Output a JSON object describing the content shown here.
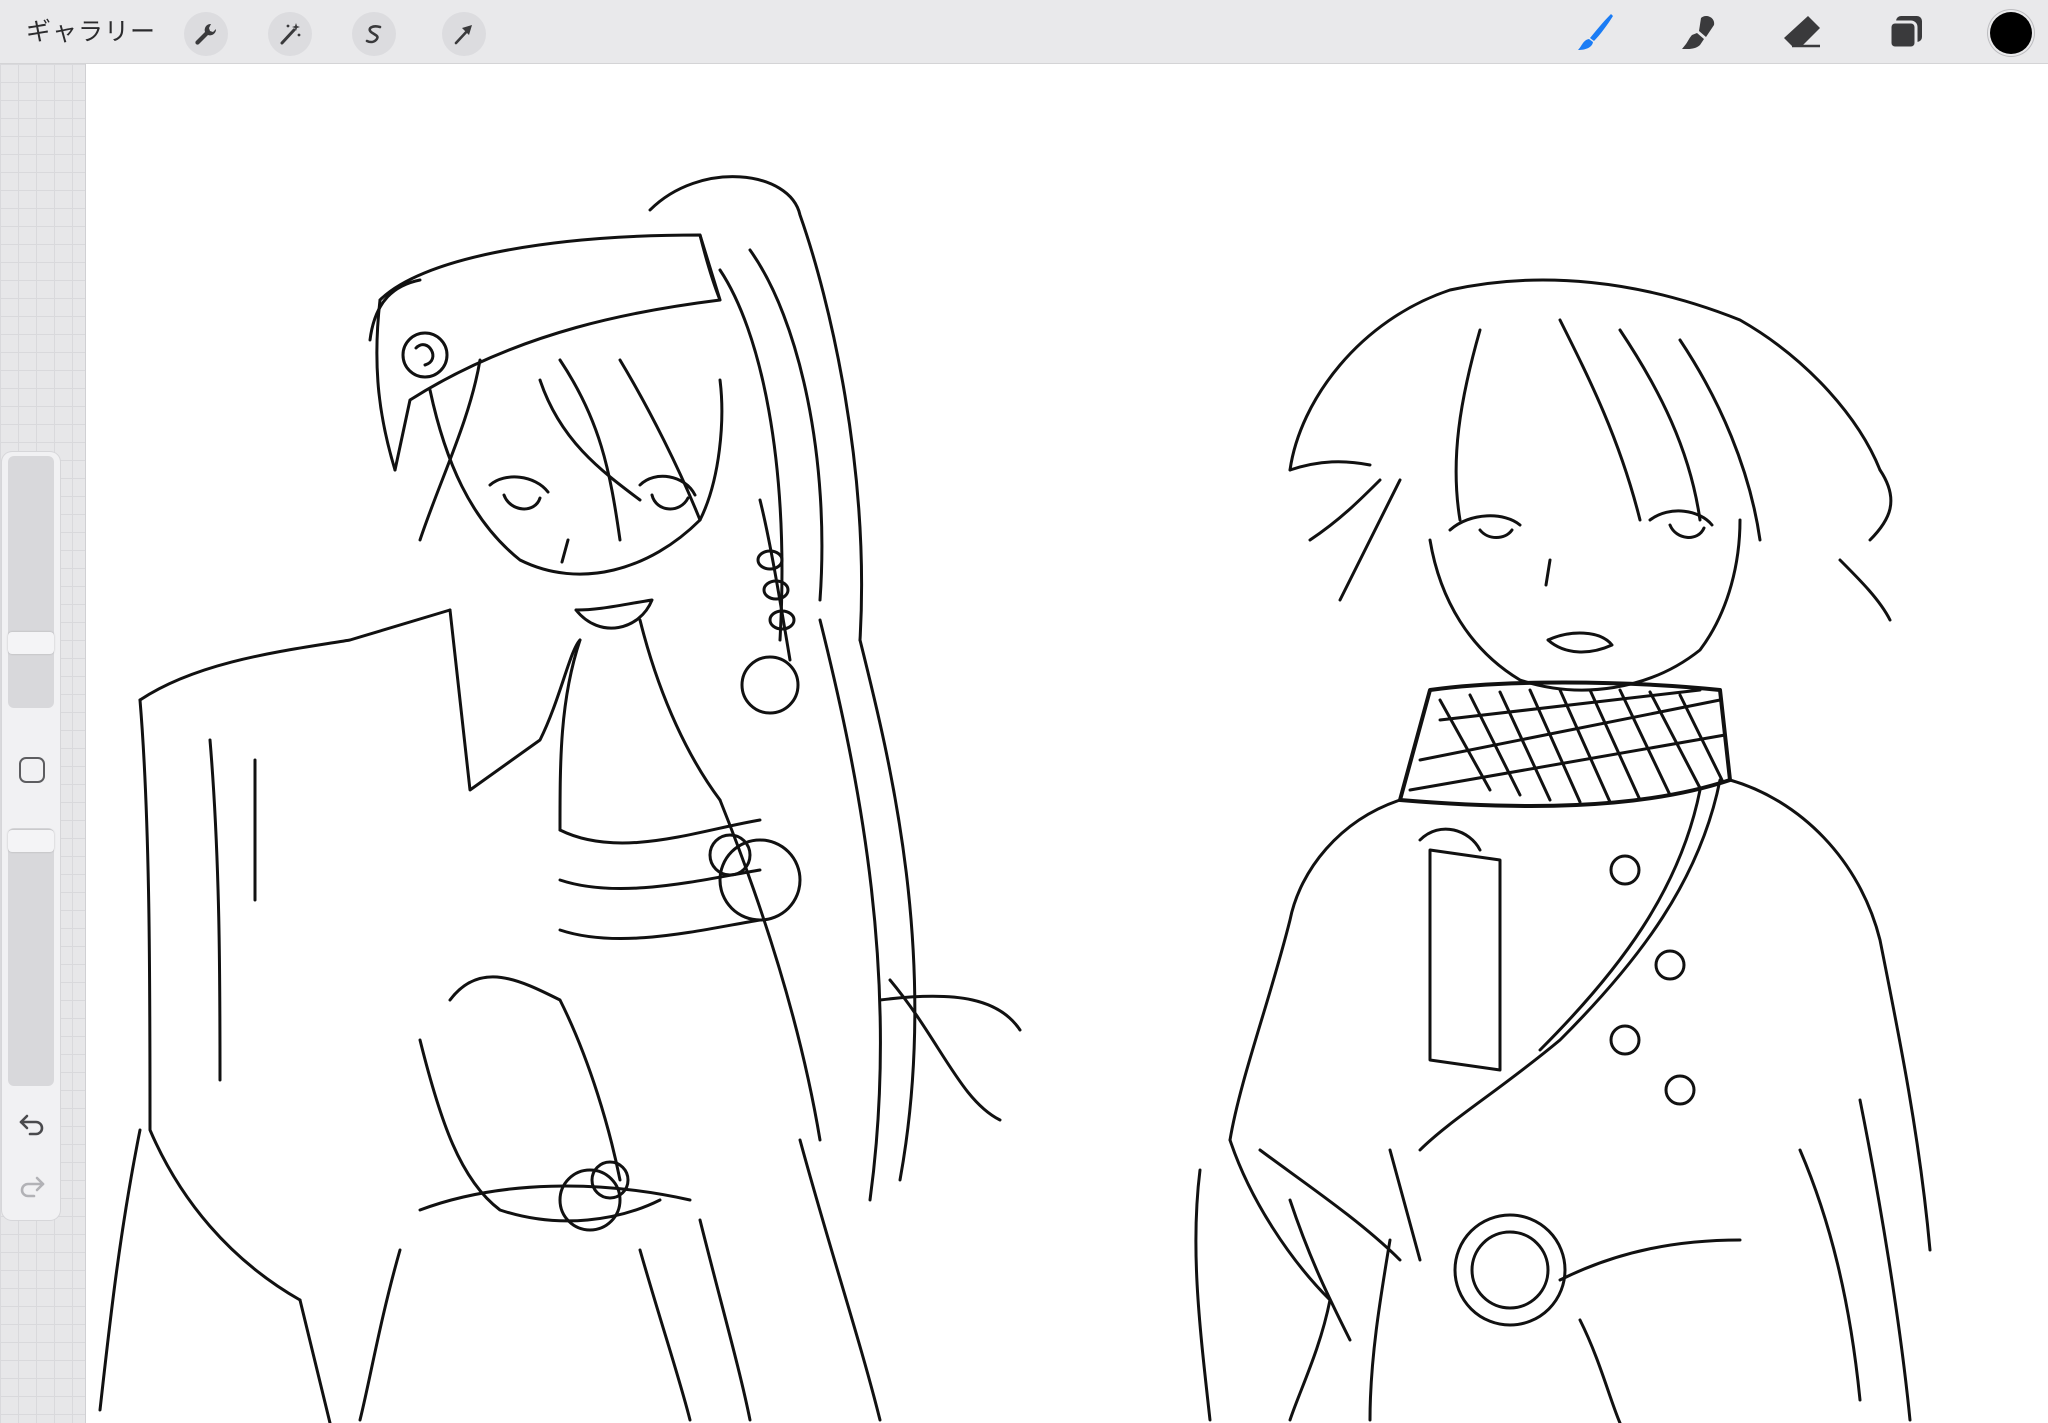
{
  "toolbar": {
    "gallery_label": "ギャラリー",
    "left_tools": [
      "wrench-icon",
      "magic-wand-icon",
      "selection-icon",
      "transform-arrow-icon"
    ],
    "right_tools": [
      "brush-icon",
      "smudge-icon",
      "eraser-icon",
      "layers-icon"
    ],
    "active_tool": "brush-icon",
    "active_color": "#000000",
    "accent": "#1a7cf5"
  },
  "sidebar": {
    "brush_size_level": 0.15,
    "opacity_level": 0.0,
    "controls": [
      "brush-size-slider",
      "modify-button",
      "opacity-slider",
      "undo-icon",
      "redo-icon"
    ]
  },
  "canvas": {
    "background": "#ffffff",
    "content": "sketch"
  }
}
